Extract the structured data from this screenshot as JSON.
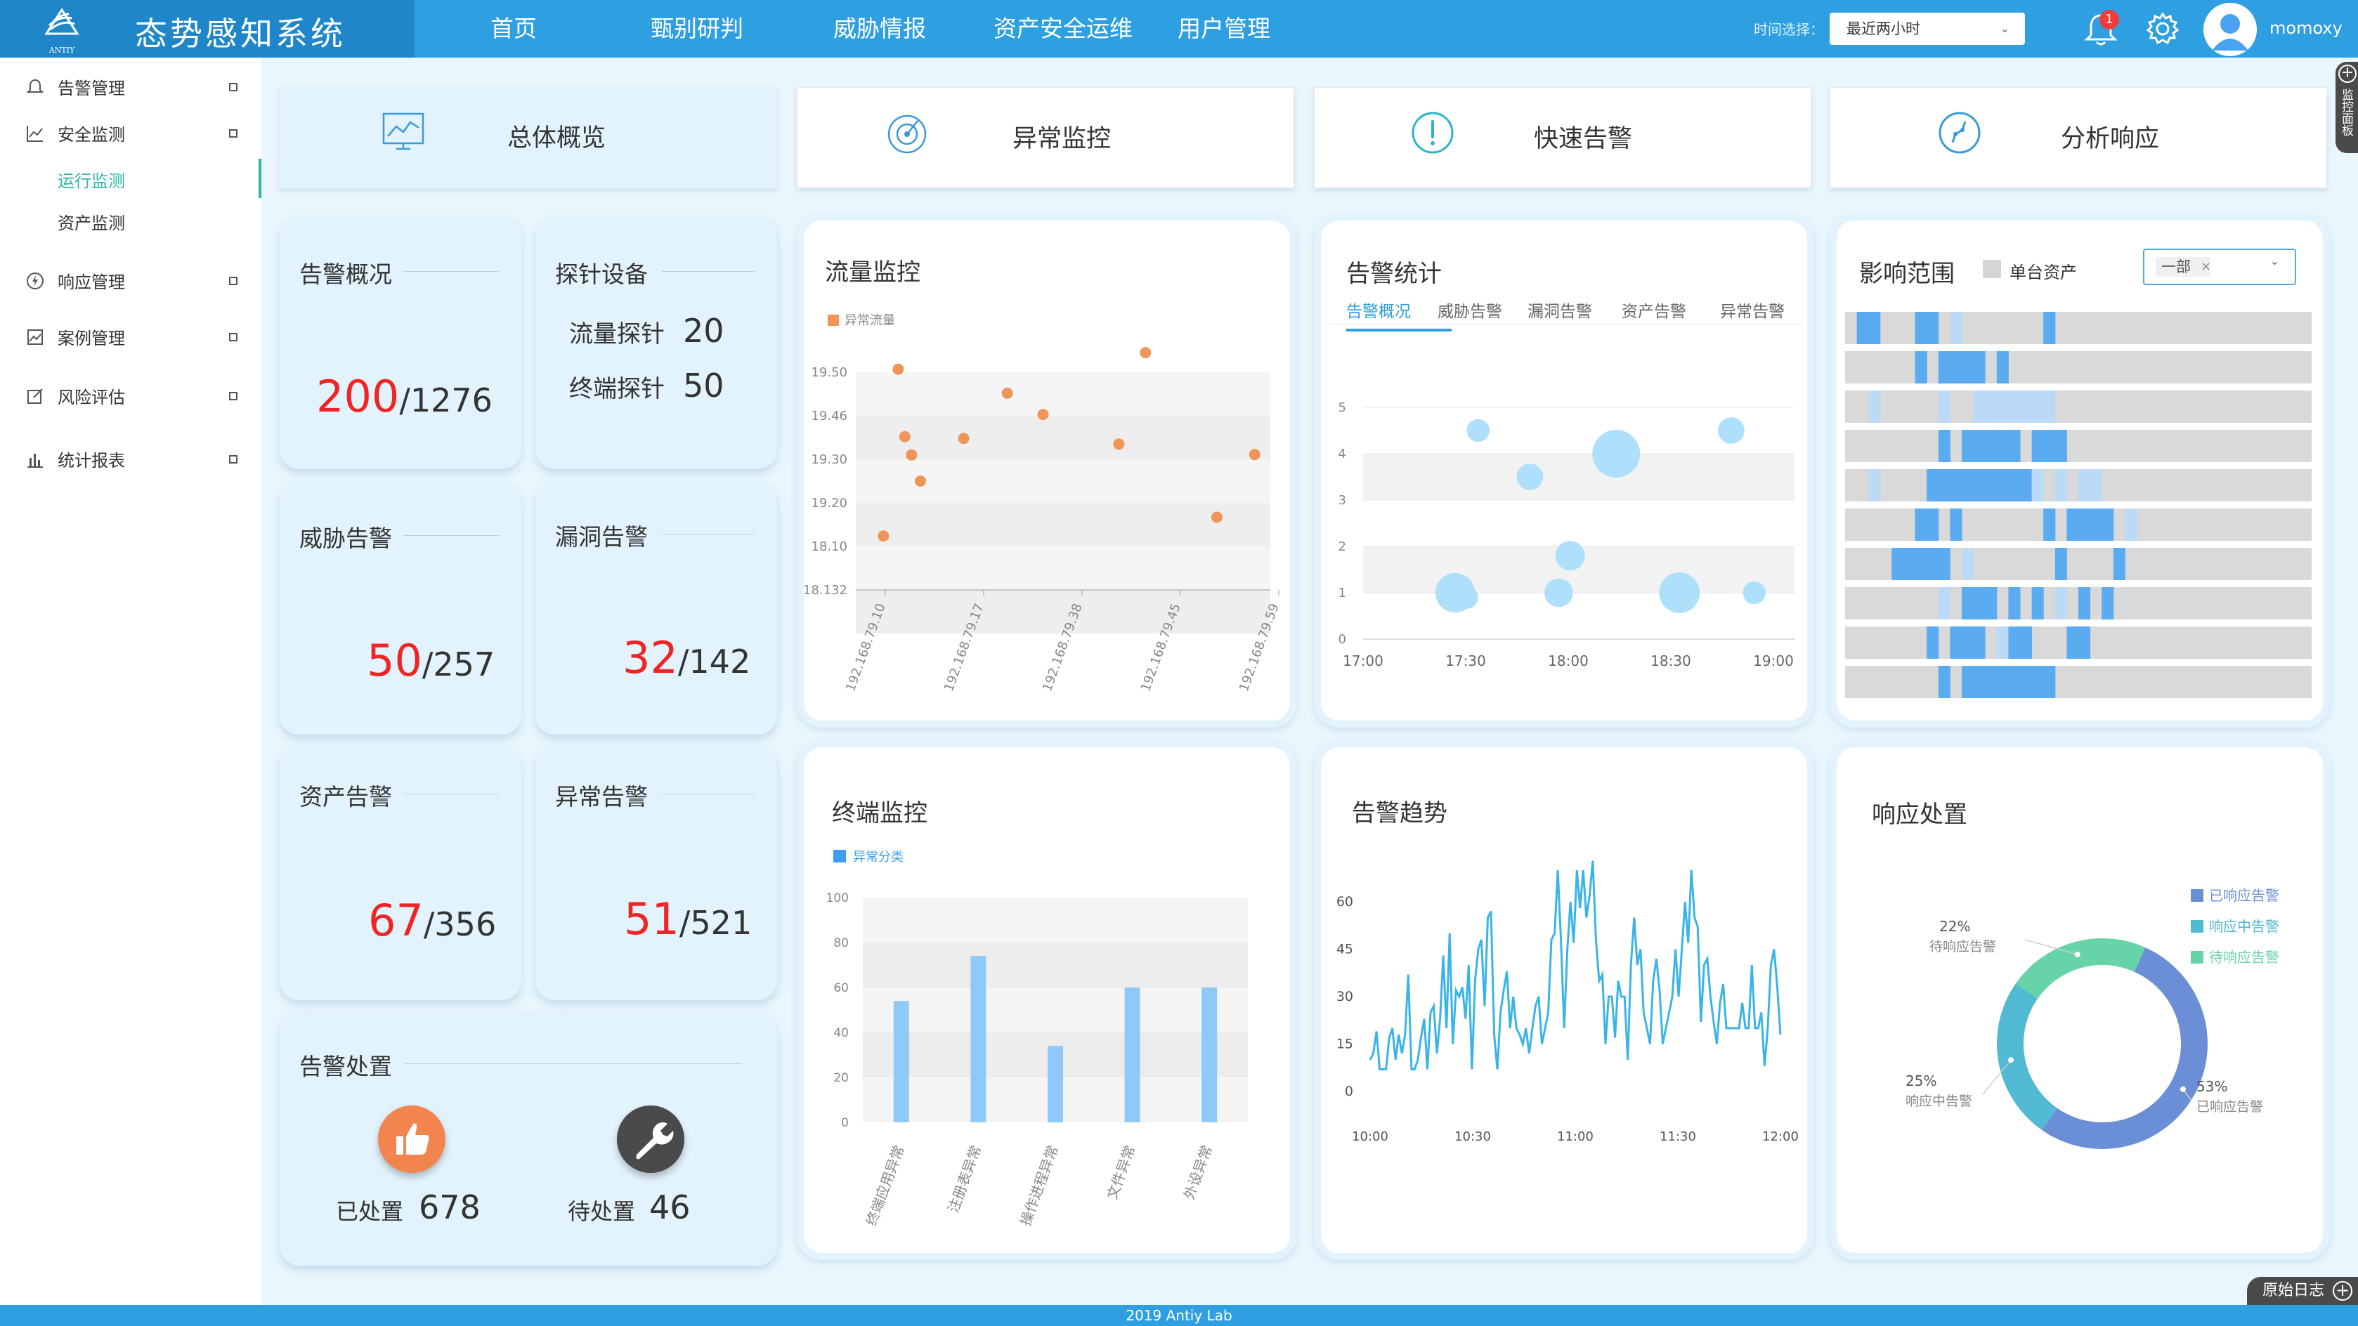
{
  "header": {
    "logo_text": "ANTIY",
    "title": "态势感知系统",
    "nav": [
      "首页",
      "甄别研判",
      "威胁情报",
      "资产安全运维",
      "用户管理"
    ],
    "time_label": "时间选择：",
    "time_value": "最近两小时",
    "notification_count": "1",
    "username": "momoxy"
  },
  "sidebar": {
    "items": [
      {
        "label": "告警管理"
      },
      {
        "label": "安全监测"
      },
      {
        "label": "运行监测"
      },
      {
        "label": "资产监测"
      },
      {
        "label": "响应管理"
      },
      {
        "label": "案例管理"
      },
      {
        "label": "风险评估"
      },
      {
        "label": "统计报表"
      }
    ]
  },
  "top_cards": [
    {
      "label": "总体概览",
      "icon": "chart-icon"
    },
    {
      "label": "异常监控",
      "icon": "radar-icon"
    },
    {
      "label": "快速告警",
      "icon": "exclamation-icon"
    },
    {
      "label": "分析响应",
      "icon": "analysis-icon"
    }
  ],
  "stats": {
    "alert_overview": {
      "title": "告警概况",
      "value": "200",
      "total": "/1276"
    },
    "probes": {
      "title": "探针设备",
      "flow_label": "流量探针",
      "flow_value": "20",
      "endpoint_label": "终端探针",
      "endpoint_value": "50"
    },
    "threat": {
      "title": "威胁告警",
      "value": "50",
      "total": "/257"
    },
    "vuln": {
      "title": "漏洞告警",
      "value": "32",
      "total": "/142"
    },
    "asset": {
      "title": "资产告警",
      "value": "67",
      "total": "/356"
    },
    "anomaly": {
      "title": "异常告警",
      "value": "51",
      "total": "/521"
    },
    "handling": {
      "title": "告警处置",
      "done_label": "已处置",
      "done_value": "678",
      "pending_label": "待处置",
      "pending_value": "46"
    }
  },
  "panels": {
    "traffic": {
      "title": "流量监控"
    },
    "alert_stats": {
      "title": "告警统计",
      "tabs": [
        "告警概况",
        "威胁告警",
        "漏洞告警",
        "资产告警",
        "异常告警"
      ]
    },
    "impact": {
      "title": "影响范围",
      "checkbox_label": "单台资产",
      "select_value": "一部",
      "select_clear": "×"
    },
    "endpoint": {
      "title": "终端监控"
    },
    "trend": {
      "title": "告警趋势"
    },
    "response": {
      "title": "响应处置"
    }
  },
  "footer": {
    "text": "2019 Antiy Lab",
    "raw_log": "原始日志",
    "side_tab": "监控面板"
  },
  "colors": {
    "accent": "#2e9fe0",
    "header_dark": "#1e86c9",
    "red": "#ef2525",
    "scatter": "#f0955a",
    "bar": "#8fc9f7",
    "bubble": "#aee0fb",
    "line": "#3ab4e8",
    "donut_a": "#6b8fd6",
    "donut_b": "#52b9d2",
    "donut_c": "#67d3a9",
    "active_nav": "#2cb7a8"
  },
  "chart_data": [
    {
      "id": "traffic",
      "type": "scatter",
      "legend": [
        "异常流量"
      ],
      "ytick_labels": [
        "19.50",
        "19.46",
        "19.30",
        "19.20",
        "18.10",
        "18.132"
      ],
      "xtick_labels": [
        "192.168.79.10",
        "192.168.79.17",
        "192.168.79.38",
        "192.168.79.45",
        "192.168.79.59"
      ],
      "series": [
        {
          "name": "异常流量",
          "points": [
            [
              0.62,
              1.24
            ],
            [
              0.95,
              5.07
            ],
            [
              1.1,
              3.52
            ],
            [
              1.25,
              3.1
            ],
            [
              1.45,
              2.5
            ],
            [
              2.42,
              3.48
            ],
            [
              3.4,
              4.52
            ],
            [
              4.2,
              4.03
            ],
            [
              5.9,
              3.35
            ],
            [
              6.5,
              5.45
            ],
            [
              8.1,
              1.67
            ],
            [
              8.95,
              3.11
            ]
          ]
        }
      ],
      "xlim": [
        0,
        9.3
      ],
      "ylim": [
        0,
        5
      ],
      "grid": true
    },
    {
      "id": "alert_stats",
      "type": "scatter",
      "xtick_labels": [
        "17:00",
        "17:30",
        "18:00",
        "18:30",
        "19:00"
      ],
      "y": [
        0,
        1,
        2,
        3,
        4,
        5
      ],
      "series": [
        {
          "name": "告警概况",
          "points": [
            [
              20,
              4.5,
              0.2
            ],
            [
              29,
              3.5,
              0.35
            ],
            [
              44,
              4.0,
              2.0
            ],
            [
              64,
              4.5,
              0.35
            ],
            [
              16,
              1.0,
              1.2
            ],
            [
              18,
              0.9,
              0.2
            ],
            [
              36,
              1.8,
              0.5
            ],
            [
              34,
              1.0,
              0.45
            ],
            [
              55,
              1.0,
              1.3
            ],
            [
              68,
              1.0,
              0.2
            ]
          ]
        }
      ],
      "xlim": [
        0,
        75
      ],
      "ylim": [
        0,
        5
      ]
    },
    {
      "id": "endpoint",
      "type": "bar",
      "legend": [
        "异常分类"
      ],
      "categories": [
        "终端应用异常",
        "注册表异常",
        "操作进程异常",
        "文件异常",
        "外设异常"
      ],
      "values": [
        54,
        74,
        34,
        60,
        60
      ],
      "y": [
        0,
        20,
        40,
        60,
        80,
        100
      ],
      "ylim": [
        0,
        100
      ]
    },
    {
      "id": "trend",
      "type": "line",
      "xtick_labels": [
        "10:00",
        "10:30",
        "11:00",
        "11:30",
        "12:00"
      ],
      "y": [
        0,
        15,
        30,
        45,
        60
      ],
      "values": [
        10,
        12,
        19,
        7,
        7,
        7,
        17,
        20,
        10,
        18,
        12,
        18,
        37,
        7,
        7,
        10,
        17,
        23,
        7,
        25,
        27,
        12,
        23,
        43,
        20,
        50,
        15,
        32,
        30,
        33,
        23,
        40,
        7,
        35,
        45,
        48,
        27,
        55,
        57,
        18,
        7,
        25,
        32,
        38,
        20,
        30,
        20,
        18,
        15,
        20,
        12,
        20,
        27,
        30,
        15,
        20,
        25,
        48,
        50,
        70,
        48,
        20,
        45,
        60,
        47,
        70,
        58,
        70,
        55,
        62,
        73,
        48,
        35,
        37,
        15,
        30,
        30,
        17,
        35,
        30,
        30,
        10,
        40,
        55,
        40,
        45,
        25,
        20,
        15,
        35,
        42,
        32,
        15,
        20,
        25,
        30,
        45,
        30,
        45,
        60,
        47,
        70,
        55,
        52,
        22,
        40,
        42,
        30,
        22,
        15,
        28,
        34,
        20,
        20,
        20,
        20,
        20,
        28,
        20,
        20,
        40,
        20,
        20,
        25,
        8,
        20,
        40,
        45,
        33,
        18
      ],
      "ylim": [
        0,
        60
      ]
    },
    {
      "id": "response",
      "type": "pie",
      "legend": [
        "已响应告警",
        "响应中告警",
        "待响应告警"
      ],
      "labels": [
        "已响应告警",
        "响应中告警",
        "待响应告警"
      ],
      "values": [
        53,
        25,
        22
      ],
      "percent_labels": [
        "53%",
        "25%",
        "22%"
      ],
      "unit": "%"
    },
    {
      "id": "impact",
      "type": "heatmap",
      "rows": [
        [
          0,
          2,
          2,
          0,
          0,
          0,
          2,
          2,
          0,
          1,
          0,
          0,
          0,
          0,
          0,
          0,
          0,
          2,
          0,
          0,
          0,
          0,
          0,
          0,
          0,
          0,
          0,
          0,
          0,
          0,
          0,
          0,
          0,
          0,
          0,
          0,
          0,
          0,
          0,
          0
        ],
        [
          0,
          0,
          0,
          0,
          0,
          0,
          2,
          0,
          2,
          2,
          2,
          2,
          0,
          2,
          0,
          0,
          0,
          0,
          0,
          0,
          0,
          0,
          0,
          0,
          0,
          0,
          0,
          0,
          0,
          0,
          0,
          0,
          0,
          0,
          0,
          0,
          0,
          0,
          0,
          0
        ],
        [
          0,
          0,
          1,
          0,
          0,
          0,
          0,
          0,
          1,
          0,
          0,
          1,
          1,
          1,
          1,
          1,
          1,
          1,
          0,
          0,
          0,
          0,
          0,
          0,
          0,
          0,
          0,
          0,
          0,
          0,
          0,
          0,
          0,
          0,
          0,
          0,
          0,
          0,
          0,
          0
        ],
        [
          0,
          0,
          0,
          0,
          0,
          0,
          0,
          0,
          2,
          0,
          2,
          2,
          2,
          2,
          2,
          0,
          2,
          2,
          2,
          0,
          0,
          0,
          0,
          0,
          0,
          0,
          0,
          0,
          0,
          0,
          0,
          0,
          0,
          0,
          0,
          0,
          0,
          0,
          0,
          0
        ],
        [
          0,
          0,
          1,
          0,
          0,
          0,
          0,
          2,
          2,
          2,
          2,
          2,
          2,
          2,
          2,
          2,
          1,
          0,
          1,
          0,
          1,
          1,
          0,
          0,
          0,
          0,
          0,
          0,
          0,
          0,
          0,
          0,
          0,
          0,
          0,
          0,
          0,
          0,
          0,
          0
        ],
        [
          0,
          0,
          0,
          0,
          0,
          0,
          2,
          2,
          0,
          2,
          0,
          0,
          0,
          0,
          0,
          0,
          0,
          2,
          0,
          2,
          2,
          2,
          2,
          0,
          1,
          0,
          0,
          0,
          0,
          0,
          0,
          0,
          0,
          0,
          0,
          0,
          0,
          0,
          0,
          0
        ],
        [
          0,
          0,
          0,
          0,
          2,
          2,
          2,
          2,
          2,
          0,
          1,
          0,
          0,
          0,
          0,
          0,
          0,
          0,
          2,
          0,
          0,
          0,
          0,
          2,
          0,
          0,
          0,
          0,
          0,
          0,
          0,
          0,
          0,
          0,
          0,
          0,
          0,
          0,
          0,
          0
        ],
        [
          0,
          0,
          0,
          0,
          0,
          0,
          0,
          0,
          1,
          0,
          2,
          2,
          2,
          0,
          2,
          0,
          2,
          0,
          1,
          0,
          2,
          0,
          2,
          0,
          0,
          0,
          0,
          0,
          0,
          0,
          0,
          0,
          0,
          0,
          0,
          0,
          0,
          0,
          0,
          0
        ],
        [
          0,
          0,
          0,
          0,
          0,
          0,
          0,
          2,
          0,
          2,
          2,
          2,
          0,
          1,
          2,
          2,
          0,
          0,
          0,
          2,
          2,
          0,
          0,
          0,
          0,
          0,
          0,
          0,
          0,
          0,
          0,
          0,
          0,
          0,
          0,
          0,
          0,
          0,
          0,
          0
        ],
        [
          0,
          0,
          0,
          0,
          0,
          0,
          0,
          0,
          2,
          0,
          2,
          2,
          2,
          2,
          2,
          2,
          2,
          2,
          0,
          0,
          0,
          0,
          0,
          0,
          0,
          0,
          0,
          0,
          0,
          0,
          0,
          0,
          0,
          0,
          0,
          0,
          0,
          0,
          0,
          0
        ]
      ],
      "legend": [
        "单台资产"
      ]
    }
  ]
}
